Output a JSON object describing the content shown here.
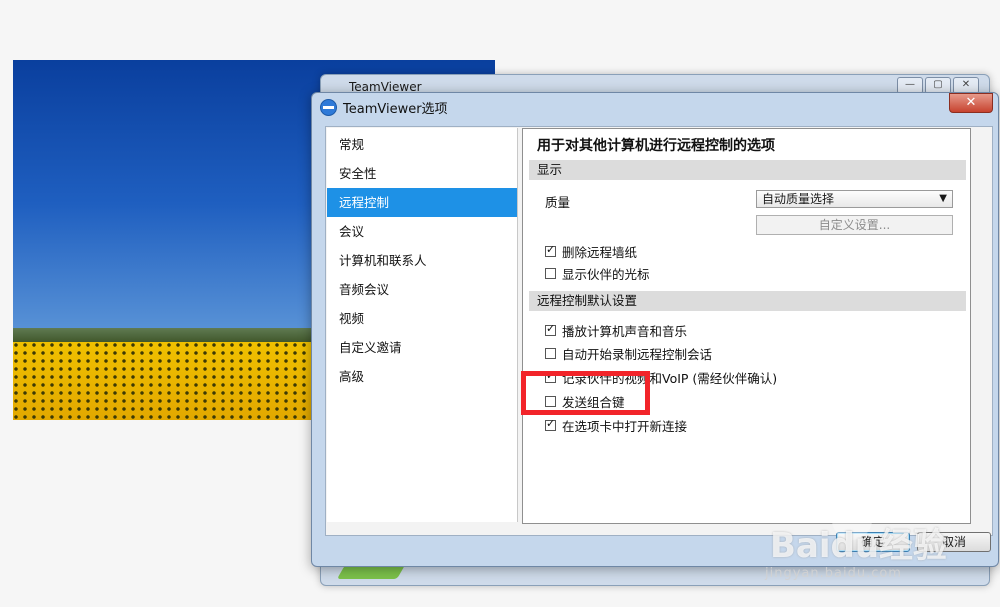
{
  "back_window": {
    "title": "TeamViewer"
  },
  "dialog": {
    "title": "TeamViewer选项",
    "close_label": "✕",
    "nav": [
      "常规",
      "安全性",
      "远程控制",
      "会议",
      "计算机和联系人",
      "音频会议",
      "视频",
      "自定义邀请",
      "高级"
    ],
    "selected_nav": "远程控制",
    "heading": "用于对其他计算机进行远程控制的选项",
    "display_section": "显示",
    "quality_label": "质量",
    "quality_value": "自动质量选择",
    "custom_settings_button": "自定义设置...",
    "display_options": [
      {
        "label": "删除远程墙纸",
        "checked": true
      },
      {
        "label": "显示伙伴的光标",
        "checked": false
      }
    ],
    "default_section": "远程控制默认设置",
    "default_options": [
      {
        "label": "播放计算机声音和音乐",
        "checked": true
      },
      {
        "label": "自动开始录制远程控制会话",
        "checked": false
      },
      {
        "label": "记录伙伴的视频和VoIP (需经伙伴确认)",
        "checked": true
      },
      {
        "label": "发送组合键",
        "checked": false
      },
      {
        "label": "在选项卡中打开新连接",
        "checked": true
      }
    ],
    "ok_label": "确定",
    "cancel_label": "取消"
  },
  "watermark": {
    "brand": "Baidu经验",
    "url": "jingyan.baidu.com"
  },
  "colors": {
    "selection": "#1e91e6",
    "highlight_box": "#f2242a"
  }
}
